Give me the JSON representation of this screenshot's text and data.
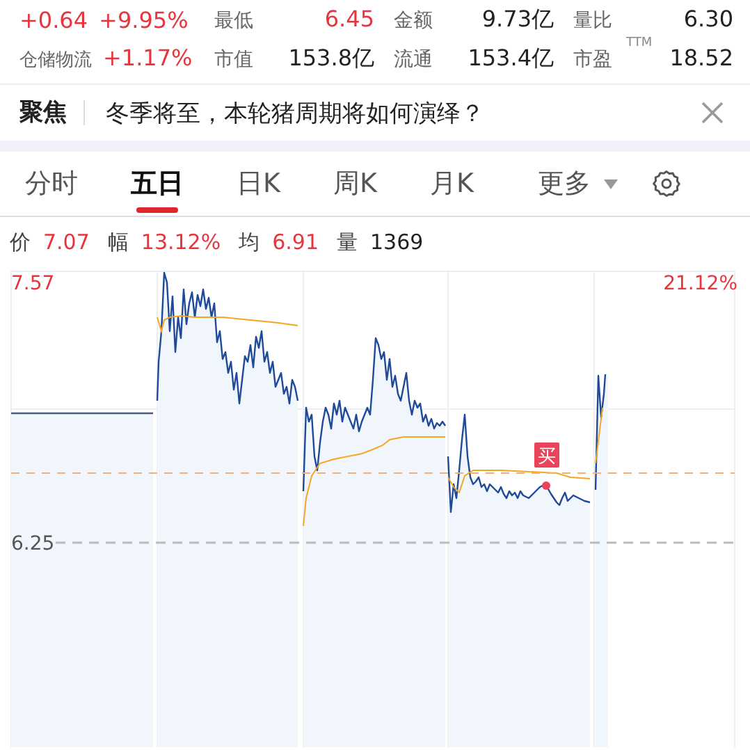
{
  "quote_rows": [
    {
      "lead": [
        {
          "text": "+0.64",
          "color": "#e8343c"
        },
        {
          "text": "+9.95%",
          "color": "#e8343c"
        }
      ],
      "stats": [
        {
          "label": "最低",
          "value": "6.45",
          "color": "#e8343c"
        },
        {
          "label": "金额",
          "value": "9.73亿",
          "color": "#222222"
        },
        {
          "label": "量比",
          "value": "6.30",
          "color": "#222222"
        }
      ]
    },
    {
      "lead": [
        {
          "text": "仓储物流",
          "color": "#666666"
        },
        {
          "text": "+1.17%",
          "color": "#e8343c"
        }
      ],
      "stats": [
        {
          "label": "市值",
          "value": "153.8亿",
          "color": "#222222"
        },
        {
          "label": "流通",
          "value": "153.4亿",
          "color": "#222222"
        },
        {
          "label": "市盈",
          "note": "TTM",
          "value": "18.52",
          "color": "#222222"
        }
      ]
    }
  ],
  "focus": {
    "tag": "聚焦",
    "headline": "冬季将至，本轮猪周期将如何演绎？"
  },
  "tabs": [
    {
      "label": "分时",
      "selected": false,
      "kind": "tab"
    },
    {
      "label": "五日",
      "selected": true,
      "kind": "tab"
    },
    {
      "label": "日K",
      "selected": false,
      "kind": "tab"
    },
    {
      "label": "周K",
      "selected": false,
      "kind": "tab"
    },
    {
      "label": "月K",
      "selected": false,
      "kind": "tab"
    },
    {
      "label": "更多",
      "selected": false,
      "kind": "menu"
    }
  ],
  "info": [
    {
      "label": "价",
      "value": "7.07",
      "color": "#e8343c"
    },
    {
      "label": "幅",
      "value": "13.12%",
      "color": "#e8343c"
    },
    {
      "label": "均",
      "value": "6.91",
      "color": "#e8343c"
    },
    {
      "label": "量",
      "value": "1369",
      "color": "#222222"
    }
  ],
  "chart": {
    "top_price": "7.57",
    "top_change": "21.12%",
    "low_price": "6.25",
    "marker": "买"
  }
}
